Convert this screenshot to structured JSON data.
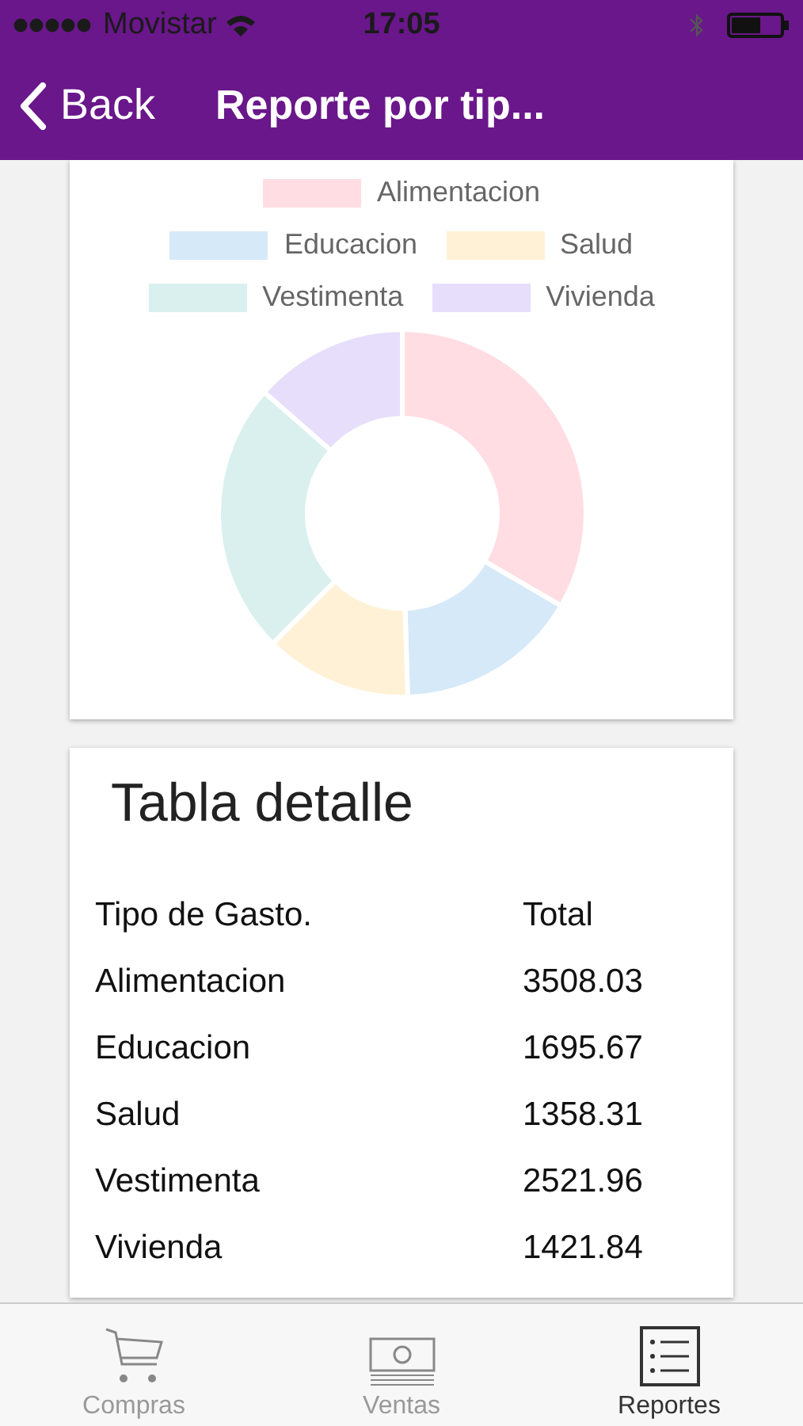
{
  "status_bar": {
    "carrier": "Movistar",
    "time": "17:05"
  },
  "nav": {
    "back": "Back",
    "title": "Reporte por tip..."
  },
  "chart_card": {
    "chart_data": {
      "type": "donut",
      "categories": [
        "Alimentacion",
        "Educacion",
        "Salud",
        "Vestimenta",
        "Vivienda"
      ],
      "values": [
        33.39,
        16.14,
        12.93,
        24.01,
        13.53
      ],
      "colors": [
        "#ffdde3",
        "#d6e9f8",
        "#fff1d6",
        "#d9f0ee",
        "#e6defa"
      ]
    }
  },
  "table_card": {
    "title": "Tabla detalle",
    "columns": [
      "Tipo de Gasto.",
      "Total"
    ],
    "rows": [
      [
        "Alimentacion",
        "3508.03"
      ],
      [
        "Educacion",
        "1695.67"
      ],
      [
        "Salud",
        "1358.31"
      ],
      [
        "Vestimenta",
        "2521.96"
      ],
      [
        "Vivienda",
        "1421.84"
      ]
    ]
  },
  "tabs": [
    {
      "label": "Compras",
      "kind": "cart",
      "selected": false
    },
    {
      "label": "Ventas",
      "kind": "money",
      "selected": false
    },
    {
      "label": "Reportes",
      "kind": "list",
      "selected": true
    }
  ]
}
